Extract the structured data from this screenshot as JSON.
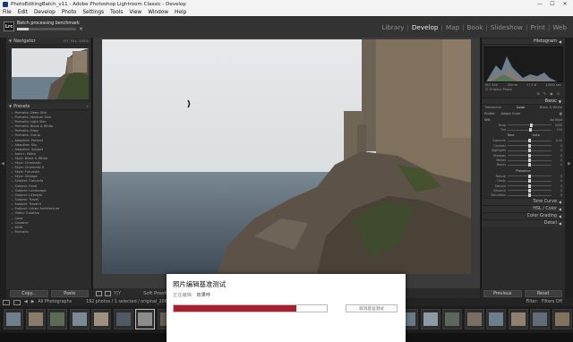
{
  "window": {
    "title": "PhotoEditingBatch_v11 - Adobe Photoshop Lightroom Classic - Develop",
    "minimize": "—",
    "maximize": "☐",
    "close": "✕"
  },
  "menu": [
    "File",
    "Edit",
    "Develop",
    "Photo",
    "Settings",
    "Tools",
    "View",
    "Window",
    "Help"
  ],
  "topbar": {
    "badge": "Lrc",
    "batch_label": "Batch processing benchmark",
    "batch_progress": 0.2,
    "batch_close": "×",
    "modules": [
      "Library",
      "Develop",
      "Map",
      "Book",
      "Slideshow",
      "Print",
      "Web"
    ],
    "active_module": "Develop"
  },
  "left_panel": {
    "navigator": "Navigator",
    "nav_modes": [
      "FIT",
      "FILL",
      "100%"
    ],
    "presets_title": "Presets",
    "presets": [
      "Portraits: Deep Skin",
      "Portraits: Medium Skin",
      "Portraits: Light Skin",
      "Portraits: Black & White",
      "Portraits: Edgy",
      "Portraits: Group",
      "Adaptive: Portrait",
      "Adaptive: Sky",
      "Adaptive: Subject",
      "Auto+: Retro",
      "Style: Black & White",
      "Style: Cinematic",
      "Style: Cinematic II",
      "Style: Futuristic",
      "Style: Vintage",
      "Subject: Concerts",
      "Subject: Food",
      "Subject: Landscape",
      "Subject: Lifestyle",
      "Subject: Travel",
      "Subject: Travel II",
      "Subject: Urban Architecture",
      "Video: Creative"
    ],
    "groups": [
      "Color",
      "Creative",
      "B&W",
      "Portraits"
    ],
    "copy": "Copy...",
    "paste": "Paste"
  },
  "toolbar": {
    "soft_proofing": "Soft Proofing"
  },
  "right_panel": {
    "histogram": "Histogram",
    "histo_info": [
      "ISO 400",
      "35mm",
      "f / 5.6",
      "1/500 sec"
    ],
    "original_photo": "Original Photo",
    "basic": "Basic",
    "treatment": [
      "Treatment:",
      "Color",
      "Black & White"
    ],
    "profile_label": "Profile:",
    "profile_value": "Adobe Color",
    "wb_label": "WB:",
    "wb_value": "As Shot",
    "sliders_wb": [
      {
        "label": "Temp",
        "value": "5000",
        "pos": 0.55
      },
      {
        "label": "Tint",
        "value": "+10",
        "pos": 0.52
      }
    ],
    "tone_head": [
      "Tone",
      "Auto"
    ],
    "sliders_tone": [
      {
        "label": "Exposure",
        "value": "0.00",
        "pos": 0.5
      },
      {
        "label": "Contrast",
        "value": "0",
        "pos": 0.5
      },
      {
        "label": "Highlights",
        "value": "0",
        "pos": 0.5
      },
      {
        "label": "Shadows",
        "value": "0",
        "pos": 0.5
      },
      {
        "label": "Whites",
        "value": "0",
        "pos": 0.5
      },
      {
        "label": "Blacks",
        "value": "0",
        "pos": 0.5
      }
    ],
    "presence_head": "Presence",
    "sliders_presence": [
      {
        "label": "Texture",
        "value": "0",
        "pos": 0.5
      },
      {
        "label": "Clarity",
        "value": "0",
        "pos": 0.5
      },
      {
        "label": "Dehaze",
        "value": "0",
        "pos": 0.5
      },
      {
        "label": "Vibrance",
        "value": "0",
        "pos": 0.5
      },
      {
        "label": "Saturation",
        "value": "0",
        "pos": 0.5
      }
    ],
    "collapsed": [
      "Tone Curve",
      "HSL / Color",
      "Color Grading",
      "Detail"
    ],
    "previous": "Previous",
    "reset": "Reset"
  },
  "filmstrip": {
    "source": "All Photographs",
    "count": "192 photos / 1 selected / original_208.dng",
    "filter_label": "Filter:",
    "filter_value": "Filters Off"
  },
  "dialog": {
    "title": "照片编辑基准测试",
    "status_label": "正在编辑:",
    "status_value": "效果呼",
    "progress": 0.8,
    "cancel": "取消基准测试"
  }
}
